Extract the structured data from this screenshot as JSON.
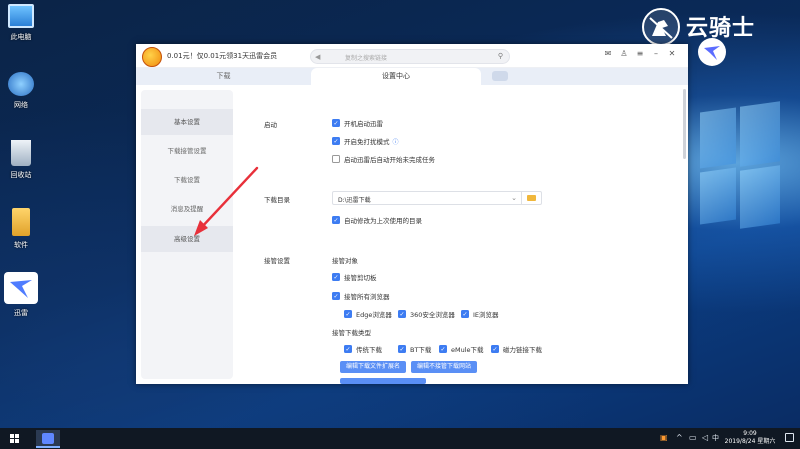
{
  "desktop": {
    "icons": [
      {
        "label": "此电脑",
        "icon": "computer-icon"
      },
      {
        "label": "网络",
        "icon": "network-icon"
      },
      {
        "label": "回收站",
        "icon": "recycle-bin-icon"
      },
      {
        "label": "软件",
        "icon": "folder-icon"
      },
      {
        "label": "迅雷",
        "icon": "xunlei-icon"
      }
    ]
  },
  "watermark": {
    "text": "云骑士"
  },
  "app": {
    "promo_text": "0.01元！仅0.01元领31天迅雷会员",
    "search_placeholder": "复制之搜索链接",
    "tabs": {
      "download": "下载",
      "settings": "设置中心"
    },
    "sidebar": [
      {
        "label": "基本设置"
      },
      {
        "label": "下载接管设置"
      },
      {
        "label": "下载设置"
      },
      {
        "label": "消息及提醒"
      },
      {
        "label": "高级设置"
      }
    ],
    "startup": {
      "section": "启动",
      "options": [
        {
          "label": "开机启动迅雷",
          "checked": true
        },
        {
          "label": "开启免打扰模式",
          "checked": true
        },
        {
          "label": "启动迅雷后自动开始未完成任务",
          "checked": false
        }
      ]
    },
    "download_dir": {
      "section": "下载目录",
      "value": "D:\\迅雷下载",
      "auto_change": {
        "label": "自动修改为上次使用的目录",
        "checked": true
      }
    },
    "takeover": {
      "section": "接管设置",
      "objects_title": "接管对象",
      "clipboard": {
        "label": "接管剪切板",
        "checked": true
      },
      "all_browsers": {
        "label": "接管所有浏览器",
        "checked": true
      },
      "browsers": [
        {
          "label": "Edge浏览器",
          "checked": true
        },
        {
          "label": "360安全浏览器",
          "checked": true
        },
        {
          "label": "IE浏览器",
          "checked": true
        }
      ],
      "types_title": "接管下载类型",
      "types": [
        {
          "label": "传统下载",
          "checked": true
        },
        {
          "label": "BT下载",
          "checked": true
        },
        {
          "label": "eMule下载",
          "checked": true
        },
        {
          "label": "磁力链接下载",
          "checked": true
        }
      ],
      "buttons": {
        "edit_extensions": "编辑下载文件扩展名",
        "edit_excluded_sites": "编辑不接管下载网站"
      }
    }
  },
  "taskbar": {
    "time": "9:09",
    "date": "2019/8/24 星期六",
    "ime": "中"
  },
  "colors": {
    "accent": "#3d7cf2",
    "annotation": "#e8303a"
  }
}
